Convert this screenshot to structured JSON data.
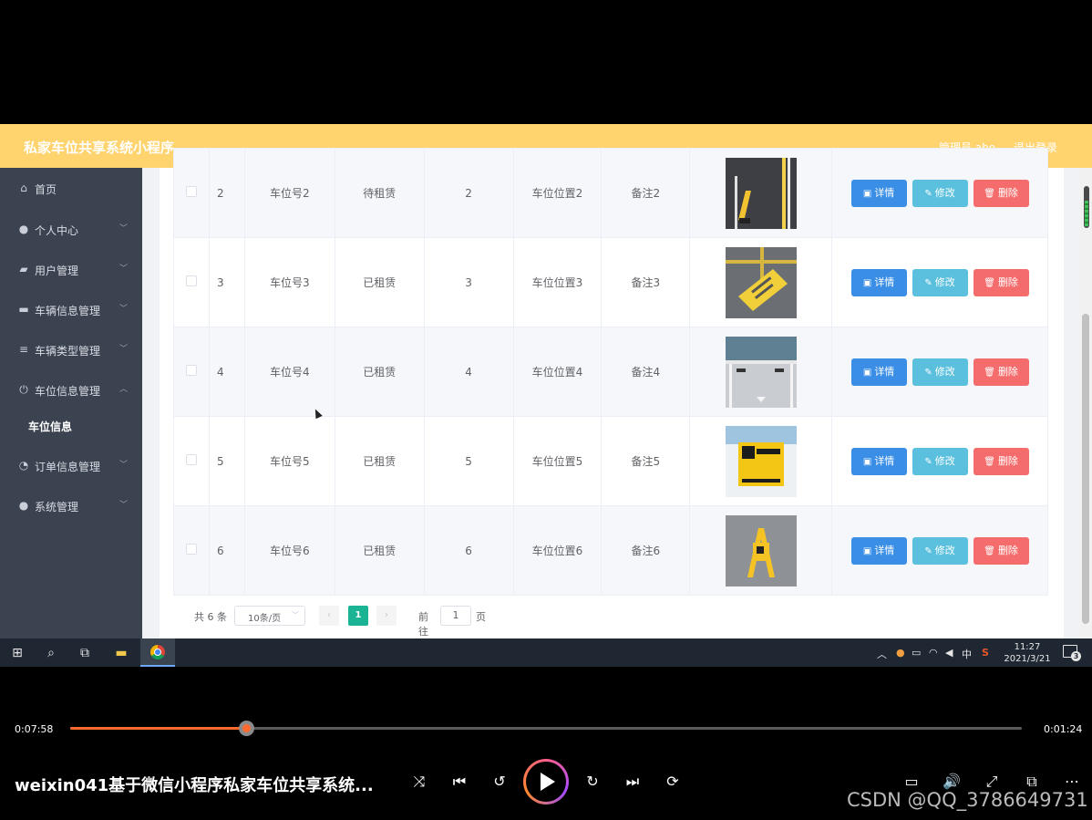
{
  "app": {
    "title": "私家车位共享系统小程序",
    "admin_label": "管理员 abo",
    "logout_label": "退出登录"
  },
  "sidebar": {
    "items": [
      {
        "label": "首页",
        "icon": "home-icon",
        "glyph": "⌂"
      },
      {
        "label": "个人中心",
        "icon": "user-icon",
        "glyph": "●"
      },
      {
        "label": "用户管理",
        "icon": "folder-icon",
        "glyph": "▰"
      },
      {
        "label": "车辆信息管理",
        "icon": "monitor-icon",
        "glyph": "▬"
      },
      {
        "label": "车辆类型管理",
        "icon": "sliders-icon",
        "glyph": "≡"
      },
      {
        "label": "车位信息管理",
        "icon": "power-icon",
        "glyph": "⏻"
      },
      {
        "label": "订单信息管理",
        "icon": "compass-icon",
        "glyph": "◔"
      },
      {
        "label": "系统管理",
        "icon": "location-icon",
        "glyph": "●"
      }
    ],
    "active_sub": "车位信息"
  },
  "table": {
    "rows": [
      {
        "index": "2",
        "number": "车位号2",
        "status": "待租赁",
        "num": "2",
        "location": "车位位置2",
        "note": "备注2"
      },
      {
        "index": "3",
        "number": "车位号3",
        "status": "已租赁",
        "num": "3",
        "location": "车位位置3",
        "note": "备注3"
      },
      {
        "index": "4",
        "number": "车位号4",
        "status": "已租赁",
        "num": "4",
        "location": "车位位置4",
        "note": "备注4"
      },
      {
        "index": "5",
        "number": "车位号5",
        "status": "已租赁",
        "num": "5",
        "location": "车位位置5",
        "note": "备注5"
      },
      {
        "index": "6",
        "number": "车位号6",
        "status": "已租赁",
        "num": "6",
        "location": "车位位置6",
        "note": "备注6"
      }
    ],
    "actions": {
      "detail": "详情",
      "edit": "修改",
      "delete": "删除"
    }
  },
  "pagination": {
    "total": "共 6 条",
    "page_size": "10条/页",
    "current_page": "1",
    "goto_label": "前往",
    "goto_value": "1",
    "page_suffix": "页"
  },
  "taskbar": {
    "ime": "中",
    "time": "11:27",
    "date": "2021/3/21",
    "notifications": "3"
  },
  "player": {
    "current_time": "0:07:58",
    "duration": "0:01:24",
    "progress": 0.185,
    "title": "weixin041基于微信小程序私家车位共享系统...",
    "watermark": "CSDN @QQ_3786649731"
  },
  "colors": {
    "header": "#ffd36e",
    "sidebar": "#3b4250",
    "btn_detail": "#3a8ee6",
    "btn_edit": "#5bc0de",
    "btn_delete": "#f56c6c",
    "page_active": "#1ab394",
    "progress": "#ff6a2f"
  }
}
